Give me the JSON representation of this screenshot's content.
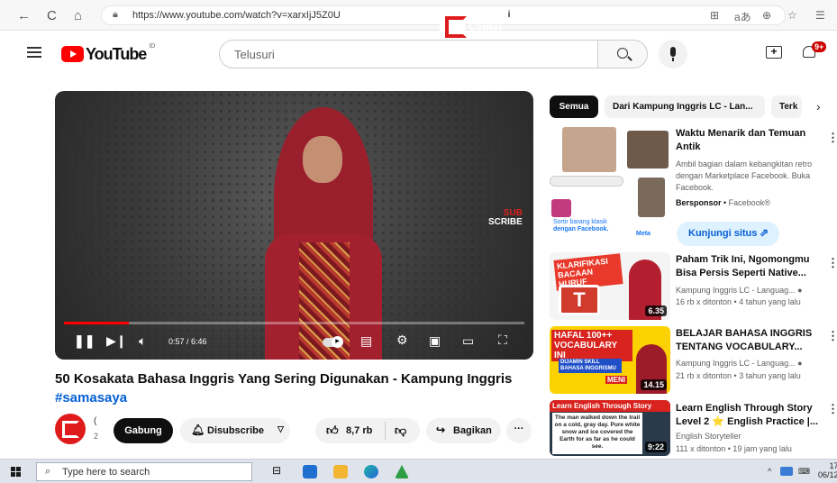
{
  "browser": {
    "url": "https://www.youtube.com/watch?v=xarxIjJ5Z0U",
    "right_icons": [
      "grid-icon",
      "read-aloud-icon",
      "zoom-icon",
      "star-icon",
      "favorites-icon"
    ]
  },
  "youtube": {
    "logo_text": "YouTube",
    "region": "ID",
    "search_placeholder": "Telusuri",
    "notif_count": "9+"
  },
  "player": {
    "brand_line1": "Langu",
    "brand_line2": "Center",
    "subscribe_overlay_top": "SUB",
    "subscribe_overlay_bottom": "SCRIBE",
    "time": "0:57 / 6:46",
    "progress": 0.14
  },
  "video": {
    "title": "50 Kosakata Bahasa Inggris Yang Sering Digunakan - Kampung Inggris",
    "hashtag": "#samasaya",
    "channel_initial": "(",
    "channel_sub": "2",
    "join_label": "Gabung",
    "subscribe_label": "Disubscribe",
    "like_count": "8,7 rb",
    "share_label": "Bagikan"
  },
  "chips": [
    "Semua",
    "Dari Kampung Inggris LC - Lan...",
    "Terk"
  ],
  "ad": {
    "title": "Waktu Menarik dan Temuan Antik",
    "desc": "Ambil bagian dalam kebangkitan retro dengan Marketplace Facebook. Buka Facebook.",
    "sponsor_label": "Bersponsor",
    "sponsor_name": "Facebook®",
    "cta": "Kunjungi situs",
    "thumb_text1": "Sortir barang klasik",
    "thumb_text2": "dengan Facebook.",
    "thumb_meta": "Meta"
  },
  "videos": [
    {
      "title": "Paham Trik Ini, Ngomongmu Bisa Persis Seperti Native...",
      "channel": "Kampung Inggris LC - Languag...",
      "meta": "16 rb x ditonton • 4 tahun yang lalu",
      "duration": "6.35",
      "thumb_caption": "KLARIFIKASI BACAAN HURUF",
      "thumb_letter": "T"
    },
    {
      "title": "BELAJAR BAHASA INGGRIS TENTANG VOCABULARY...",
      "channel": "Kampung Inggris LC - Languag...",
      "meta": "21 rb x ditonton • 3 tahun yang lalu",
      "duration": "14.15",
      "thumb_caption": "HAFAL 100++ VOCABULARY INI",
      "thumb_sub": "DIJAMIN SKILL BAHASA INGGRISMU",
      "thumb_sub2": "MENI"
    },
    {
      "title": "Learn English Through Story Level 2 ⭐ English Practice |...",
      "channel": "English Storyteller",
      "meta": "111 x ditonton • 19 jam yang lalu",
      "duration": "9:22",
      "thumb_caption": "Learn English Through Story",
      "thumb_story": "The man walked down the trail on a cold, gray day. Pure white snow and ice covered the Earth for as far as he could see."
    }
  ],
  "taskbar": {
    "search_placeholder": "Type here to search",
    "clock_time": "17",
    "clock_date": "06/12"
  },
  "colors": {
    "yt_red": "#ff0000",
    "link_blue": "#065fd4",
    "chip_active": "#0f0f0f"
  }
}
